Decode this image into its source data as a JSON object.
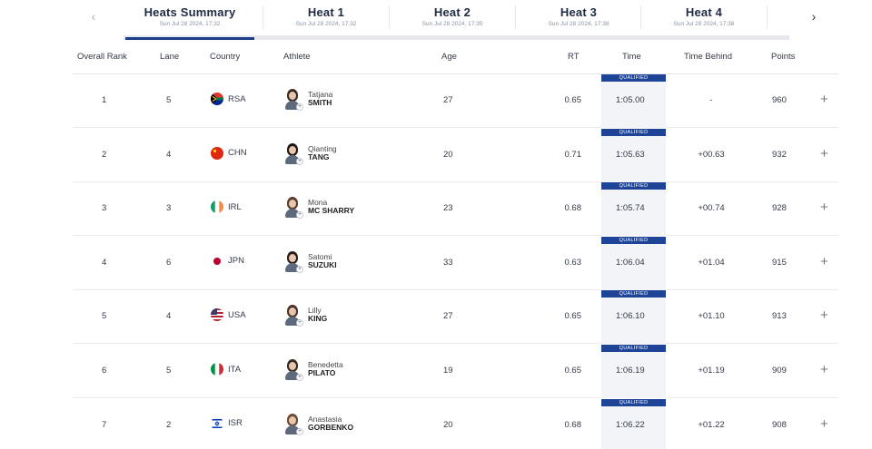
{
  "nav": {
    "prev_icon": "‹",
    "next_icon": "›"
  },
  "tabs": [
    {
      "title": "Heats Summary",
      "date": "Sun Jul 28 2024, 17:32",
      "active": true
    },
    {
      "title": "Heat 1",
      "date": "Sun Jul 28 2024, 17:32"
    },
    {
      "title": "Heat 2",
      "date": "Sun Jul 28 2024, 17:35"
    },
    {
      "title": "Heat 3",
      "date": "Sun Jul 28 2024, 17:38"
    },
    {
      "title": "Heat 4",
      "date": "Sun Jul 28 2024, 17:38"
    }
  ],
  "columns": {
    "rank": "Overall Rank",
    "lane": "Lane",
    "country": "Country",
    "athlete": "Athlete",
    "age": "Age",
    "rt": "RT",
    "time": "Time",
    "behind": "Time Behind",
    "points": "Points"
  },
  "qualified_label": "QUALIFIED",
  "expand_icon": "+",
  "rows": [
    {
      "rank": "1",
      "lane": "5",
      "country": "RSA",
      "flag": "rsa",
      "first": "Tatjana",
      "last": "SMITH",
      "age": "27",
      "rt": "0.65",
      "time": "1:05.00",
      "behind": "-",
      "points": "960"
    },
    {
      "rank": "2",
      "lane": "4",
      "country": "CHN",
      "flag": "chn",
      "first": "Qianting",
      "last": "TANG",
      "age": "20",
      "rt": "0.71",
      "time": "1:05.63",
      "behind": "+00.63",
      "points": "932"
    },
    {
      "rank": "3",
      "lane": "3",
      "country": "IRL",
      "flag": "irl",
      "first": "Mona",
      "last": "MC SHARRY",
      "age": "23",
      "rt": "0.68",
      "time": "1:05.74",
      "behind": "+00.74",
      "points": "928"
    },
    {
      "rank": "4",
      "lane": "6",
      "country": "JPN",
      "flag": "jpn",
      "first": "Satomi",
      "last": "SUZUKI",
      "age": "33",
      "rt": "0.63",
      "time": "1:06.04",
      "behind": "+01.04",
      "points": "915"
    },
    {
      "rank": "5",
      "lane": "4",
      "country": "USA",
      "flag": "usa",
      "first": "Lilly",
      "last": "KING",
      "age": "27",
      "rt": "0.65",
      "time": "1:06.10",
      "behind": "+01.10",
      "points": "913"
    },
    {
      "rank": "6",
      "lane": "5",
      "country": "ITA",
      "flag": "ita",
      "first": "Benedetta",
      "last": "PILATO",
      "age": "19",
      "rt": "0.65",
      "time": "1:06.19",
      "behind": "+01.19",
      "points": "909"
    },
    {
      "rank": "7",
      "lane": "2",
      "country": "ISR",
      "flag": "isr",
      "first": "Anastasia",
      "last": "GORBENKO",
      "age": "20",
      "rt": "0.68",
      "time": "1:06.22",
      "behind": "+01.22",
      "points": "908"
    }
  ]
}
